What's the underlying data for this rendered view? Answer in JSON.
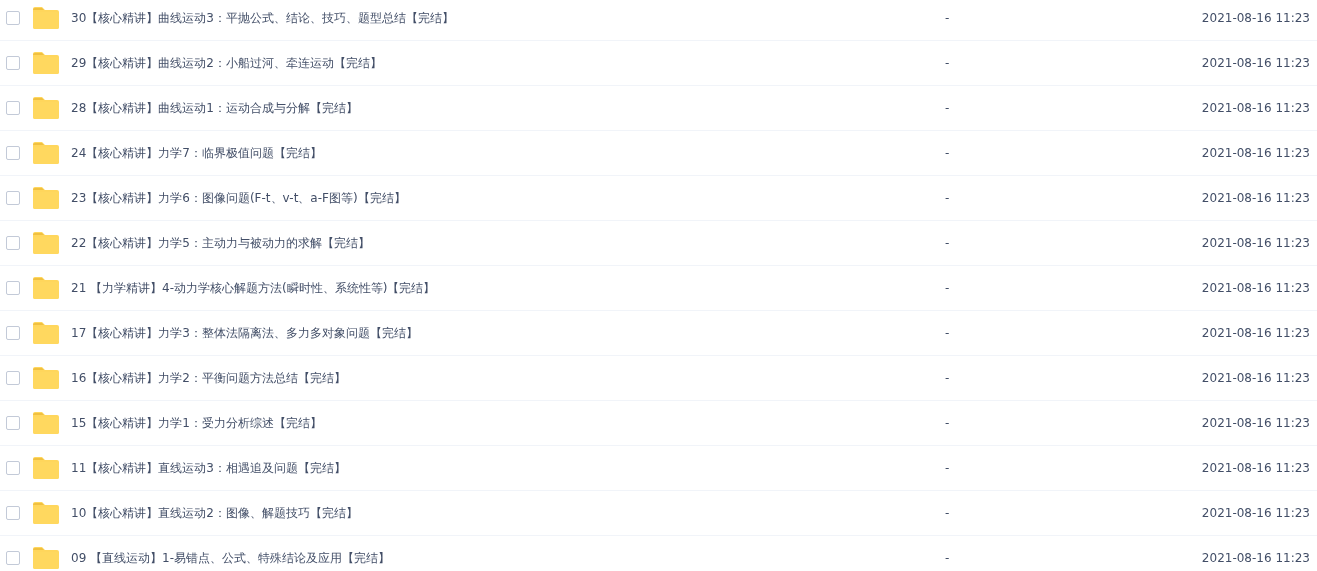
{
  "files": [
    {
      "name": "30【核心精讲】曲线运动3：平抛公式、结论、技巧、题型总结【完结】",
      "size": "-",
      "modified": "2021-08-16 11:23",
      "checked": false
    },
    {
      "name": "29【核心精讲】曲线运动2：小船过河、牵连运动【完结】",
      "size": "-",
      "modified": "2021-08-16 11:23",
      "checked": false
    },
    {
      "name": "28【核心精讲】曲线运动1：运动合成与分解【完结】",
      "size": "-",
      "modified": "2021-08-16 11:23",
      "checked": false
    },
    {
      "name": "24【核心精讲】力学7：临界极值问题【完结】",
      "size": "-",
      "modified": "2021-08-16 11:23",
      "checked": false
    },
    {
      "name": "23【核心精讲】力学6：图像问题(F-t、v-t、a-F图等)【完结】",
      "size": "-",
      "modified": "2021-08-16 11:23",
      "checked": false
    },
    {
      "name": "22【核心精讲】力学5：主动力与被动力的求解【完结】",
      "size": "-",
      "modified": "2021-08-16 11:23",
      "checked": false
    },
    {
      "name": "21 【力学精讲】4-动力学核心解题方法(瞬时性、系统性等)【完结】",
      "size": "-",
      "modified": "2021-08-16 11:23",
      "checked": false
    },
    {
      "name": "17【核心精讲】力学3：整体法隔离法、多力多对象问题【完结】",
      "size": "-",
      "modified": "2021-08-16 11:23",
      "checked": false
    },
    {
      "name": "16【核心精讲】力学2：平衡问题方法总结【完结】",
      "size": "-",
      "modified": "2021-08-16 11:23",
      "checked": false
    },
    {
      "name": "15【核心精讲】力学1：受力分析综述【完结】",
      "size": "-",
      "modified": "2021-08-16 11:23",
      "checked": false
    },
    {
      "name": "11【核心精讲】直线运动3：相遇追及问题【完结】",
      "size": "-",
      "modified": "2021-08-16 11:23",
      "checked": false
    },
    {
      "name": "10【核心精讲】直线运动2：图像、解题技巧【完结】",
      "size": "-",
      "modified": "2021-08-16 11:23",
      "checked": false
    },
    {
      "name": "09 【直线运动】1-易错点、公式、特殊结论及应用【完结】",
      "size": "-",
      "modified": "2021-08-16 11:23",
      "checked": false
    }
  ]
}
